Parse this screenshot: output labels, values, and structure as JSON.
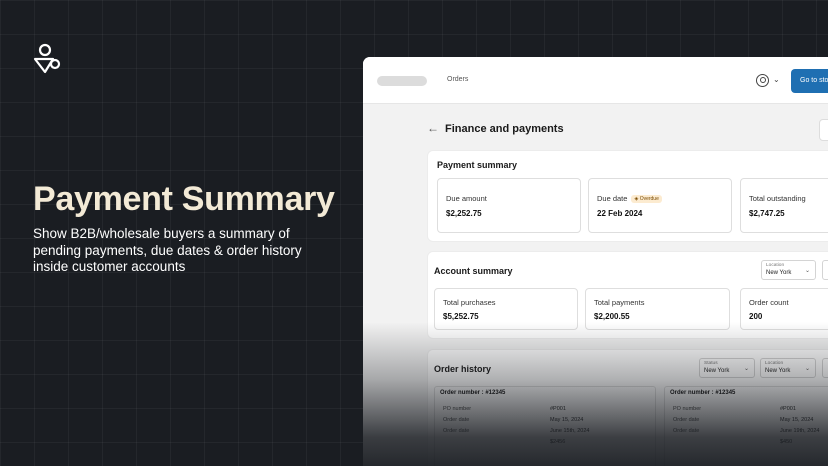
{
  "hero": {
    "title": "Payment Summary",
    "subtitle": "Show B2B/wholesale buyers a summary of pending payments, due dates & order history inside customer accounts"
  },
  "topbar": {
    "nav_orders": "Orders",
    "store_button": "Go to store"
  },
  "page": {
    "title": "Finance and payments"
  },
  "payment_summary": {
    "title": "Payment summary",
    "stats": [
      {
        "label": "Due amount",
        "value": "$2,252.75"
      },
      {
        "label": "Due date",
        "value": "22 Feb 2024",
        "badge": "Overdue"
      },
      {
        "label": "Total outstanding",
        "value": "$2,747.25"
      }
    ]
  },
  "account_summary": {
    "title": "Account summary",
    "location_label": "Location",
    "location_value": "New York",
    "stats": [
      {
        "label": "Total purchases",
        "value": "$5,252.75"
      },
      {
        "label": "Total payments",
        "value": "$2,200.55"
      },
      {
        "label": "Order count",
        "value": "200"
      }
    ]
  },
  "order_history": {
    "title": "Order history",
    "status_label": "Status",
    "status_value": "New York",
    "location_label": "Location",
    "location_value": "New York",
    "orders": [
      {
        "title": "Order number : #12345",
        "rows": [
          {
            "label": "PO number",
            "value": "#P001"
          },
          {
            "label": "Order date",
            "value": "May 15, 2024"
          },
          {
            "label": "Order date",
            "value": "June 15th, 2024"
          },
          {
            "label": "",
            "value": "$2456"
          }
        ]
      },
      {
        "title": "Order number : #12345",
        "rows": [
          {
            "label": "PO number",
            "value": "#P001"
          },
          {
            "label": "Order date",
            "value": "May 15, 2024"
          },
          {
            "label": "Order date",
            "value": "June 19th, 2024"
          },
          {
            "label": "",
            "value": "$450"
          }
        ]
      }
    ]
  },
  "colors": {
    "background": "#1a1d22",
    "hero_title": "#f3ead6",
    "accent_button": "#1f6fb2",
    "overdue_badge": "#fcebd0"
  }
}
